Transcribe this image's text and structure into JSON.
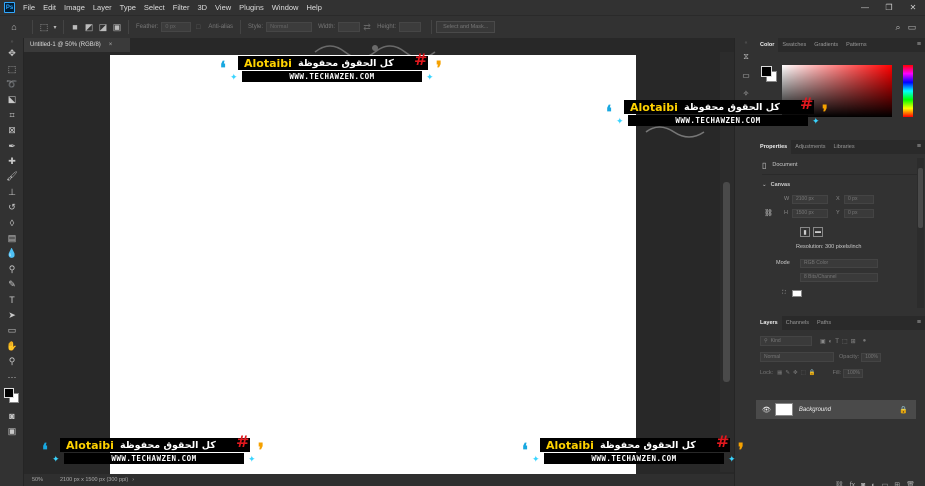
{
  "app": {
    "logo": "Ps"
  },
  "menu": [
    "File",
    "Edit",
    "Image",
    "Layer",
    "Type",
    "Select",
    "Filter",
    "3D",
    "View",
    "Plugins",
    "Window",
    "Help"
  ],
  "options": {
    "feather_label": "Feather:",
    "feather_value": "0 px",
    "antialias_label": "Anti-alias",
    "style_label": "Style:",
    "style_value": "Normal",
    "width_label": "Width:",
    "height_label": "Height:",
    "select_mask": "Select and Mask..."
  },
  "document": {
    "tab_title": "Untitled-1 @ 50% (RGB/8)",
    "close": "×"
  },
  "status": {
    "zoom": "50%",
    "info": "2100 px x 1500 px (300 ppi)"
  },
  "color_panel": {
    "tabs": [
      "Color",
      "Swatches",
      "Gradients",
      "Patterns"
    ],
    "active": "Color"
  },
  "properties_panel": {
    "tabs": [
      "Properties",
      "Adjustments",
      "Libraries"
    ],
    "doc_label": "Document",
    "section": "Canvas",
    "w_label": "W",
    "w_value": "2100 px",
    "h_label": "H",
    "h_value": "1500 px",
    "x_label": "X",
    "x_value": "0 px",
    "y_label": "Y",
    "y_value": "0 px",
    "resolution": "Resolution: 300 pixels/inch",
    "mode_label": "Mode",
    "mode_value": "RGB Color",
    "depth_value": "8 Bits/Channel"
  },
  "layers_panel": {
    "tabs": [
      "Layers",
      "Channels",
      "Paths"
    ],
    "kind": "Kind",
    "blend": "Normal",
    "opacity_label": "Opacity:",
    "opacity_value": "100%",
    "lock_label": "Lock:",
    "fill_label": "Fill:",
    "fill_value": "100%",
    "layer_name": "Background"
  },
  "watermark": {
    "brand": "Alotaibi",
    "arabic": "كل الحقوق محفوظة",
    "hash": "#",
    "url": "WWW.TECHAWZEN.COM"
  }
}
